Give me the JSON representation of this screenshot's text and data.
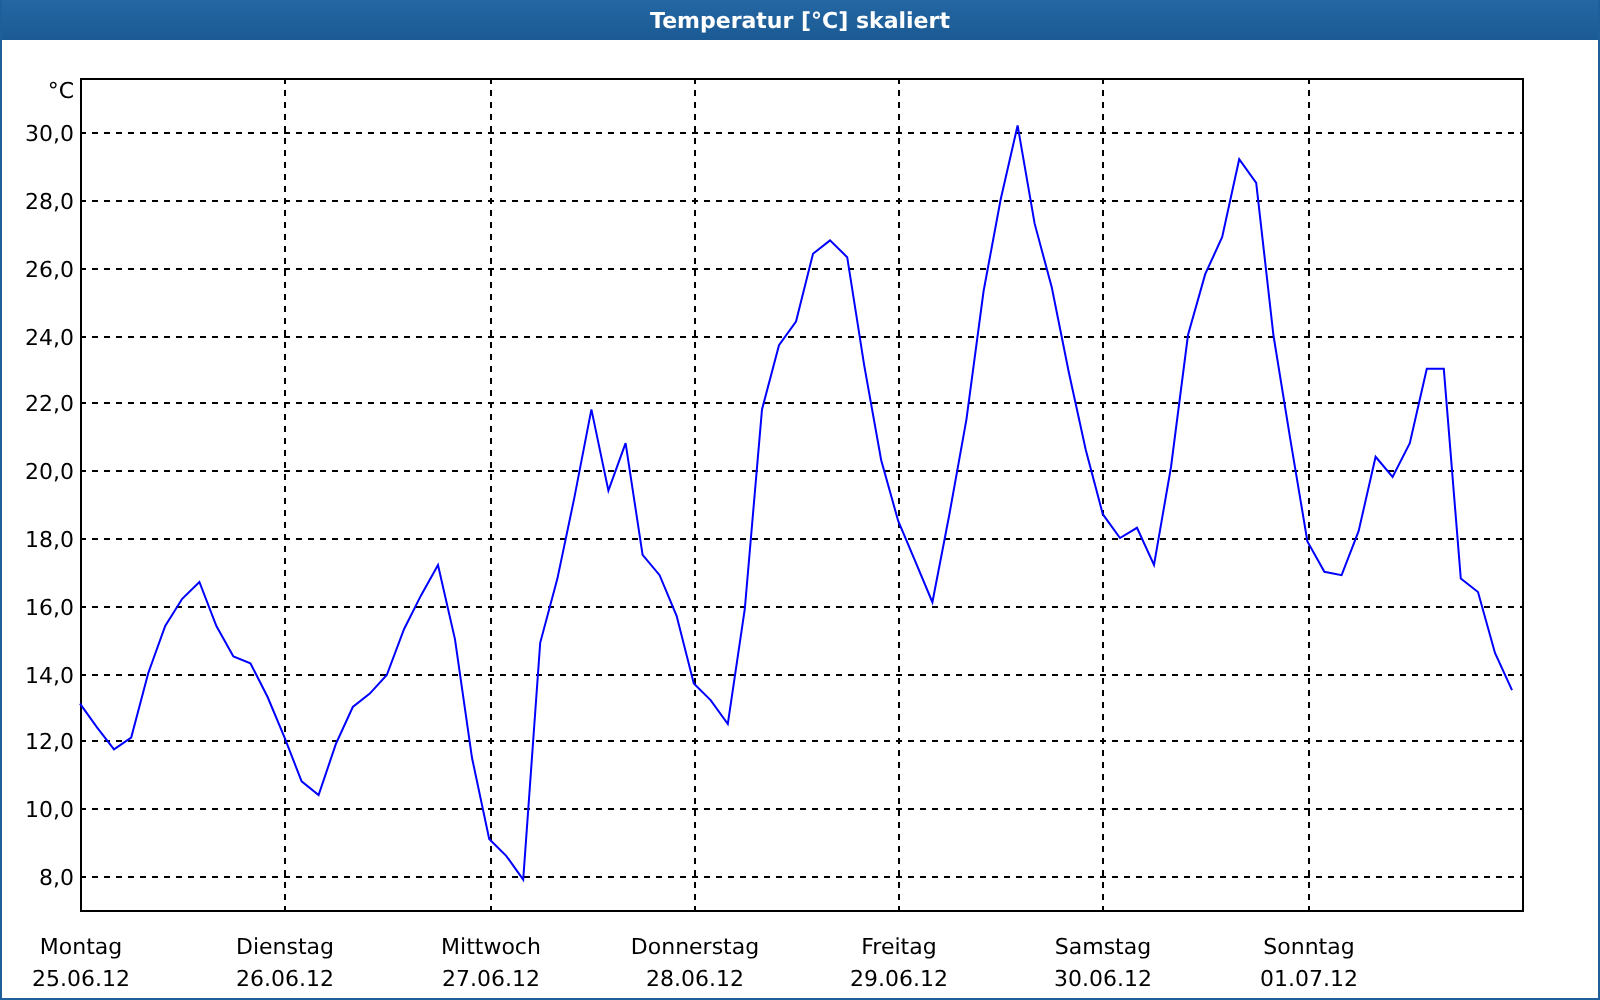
{
  "window": {
    "title": "Temperatur [°C] skaliert"
  },
  "chart": {
    "x_days": [
      "Montag",
      "Dienstag",
      "Mittwoch",
      "Donnerstag",
      "Freitag",
      "Samstag",
      "Sonntag"
    ],
    "chart_data": {
      "type": "line",
      "grid": true,
      "ylabel": "°C",
      "ylim": [
        7.0,
        31.6
      ],
      "yticks": [
        {
          "value": 8,
          "label": "8,0"
        },
        {
          "value": 10,
          "label": "10,0"
        },
        {
          "value": 12,
          "label": "12,0"
        },
        {
          "value": 14,
          "label": "14,0"
        },
        {
          "value": 16,
          "label": "16,0"
        },
        {
          "value": 18,
          "label": "18,0"
        },
        {
          "value": 20,
          "label": "20,0"
        },
        {
          "value": 22,
          "label": "22,0"
        },
        {
          "value": 24,
          "label": "24,0"
        },
        {
          "value": 26,
          "label": "26,0"
        },
        {
          "value": 28,
          "label": "28,0"
        },
        {
          "value": 30,
          "label": "30,0"
        }
      ],
      "categories": [
        "25.06.12",
        null,
        null,
        null,
        null,
        null,
        null,
        null,
        null,
        null,
        null,
        null,
        "26.06.12",
        null,
        null,
        null,
        null,
        null,
        null,
        null,
        null,
        null,
        null,
        null,
        "27.06.12",
        null,
        null,
        null,
        null,
        null,
        null,
        null,
        null,
        null,
        null,
        null,
        "28.06.12",
        null,
        null,
        null,
        null,
        null,
        null,
        null,
        null,
        null,
        null,
        null,
        "29.06.12",
        null,
        null,
        null,
        null,
        null,
        null,
        null,
        null,
        null,
        null,
        null,
        "30.06.12",
        null,
        null,
        null,
        null,
        null,
        null,
        null,
        null,
        null,
        null,
        null,
        "01.07.12",
        null,
        null,
        null,
        null,
        null,
        null,
        null,
        null,
        null,
        null,
        null,
        null
      ],
      "series": [
        {
          "color": "#0000ff",
          "values": [
            13.1,
            12.4,
            11.75,
            12.1,
            14.0,
            15.4,
            16.2,
            16.7,
            15.4,
            14.5,
            14.3,
            13.3,
            12.1,
            10.8,
            10.4,
            11.9,
            13.0,
            13.4,
            13.95,
            15.3,
            16.3,
            17.2,
            15.0,
            11.5,
            9.1,
            8.6,
            7.9,
            14.9,
            16.8,
            19.2,
            21.8,
            19.4,
            20.8,
            17.5,
            16.9,
            15.7,
            13.7,
            13.2,
            12.5,
            15.9,
            21.8,
            23.7,
            24.4,
            26.4,
            26.8,
            26.3,
            23.1,
            20.3,
            18.5,
            17.3,
            16.1,
            18.7,
            21.5,
            25.3,
            28.0,
            30.2,
            27.3,
            25.4,
            22.9,
            20.6,
            18.7,
            18.0,
            18.3,
            17.2,
            20.1,
            24.0,
            25.8,
            26.9,
            29.2,
            28.5,
            24.0,
            20.9,
            17.9,
            17.0,
            16.9,
            18.2,
            20.4,
            19.8,
            20.8,
            23.0,
            23.0,
            16.8,
            16.4,
            14.6,
            13.5
          ]
        }
      ]
    }
  }
}
